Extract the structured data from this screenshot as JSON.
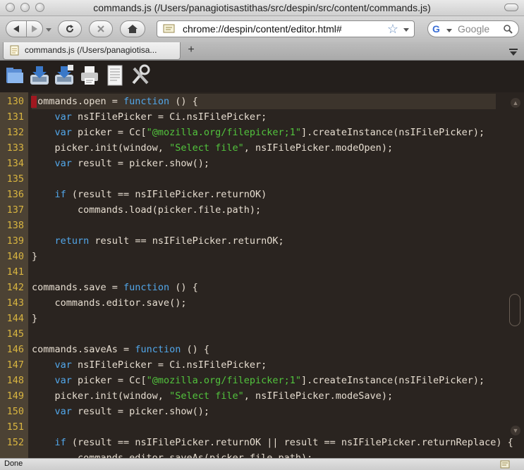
{
  "window": {
    "title": "commands.js (/Users/panagiotisastithas/src/despin/src/content/commands.js)"
  },
  "nav": {
    "url": "chrome://despin/content/editor.html#",
    "search_placeholder": "Google"
  },
  "tab": {
    "label": "commands.js (/Users/panagiotisa...",
    "add_label": "+"
  },
  "editor_tools": [
    "open-file-icon",
    "save-icon",
    "save-as-icon",
    "print-icon",
    "document-icon",
    "settings-icon"
  ],
  "colors": {
    "keyword": "#52a7ea",
    "string": "#52c33d",
    "line_number": "#d9b540",
    "text": "#e6ddd0",
    "cursor": "#a01820"
  },
  "code": {
    "lines": [
      {
        "num": "130",
        "parts": [
          {
            "t": "commands.open = "
          },
          {
            "t": "function",
            "c": "kw"
          },
          {
            "t": " () {"
          }
        ]
      },
      {
        "num": "131",
        "parts": [
          {
            "t": "    "
          },
          {
            "t": "var",
            "c": "kw"
          },
          {
            "t": " nsIFilePicker = Ci.nsIFilePicker;"
          }
        ]
      },
      {
        "num": "132",
        "parts": [
          {
            "t": "    "
          },
          {
            "t": "var",
            "c": "kw"
          },
          {
            "t": " picker = Cc["
          },
          {
            "t": "\"@mozilla.org/filepicker;1\"",
            "c": "str"
          },
          {
            "t": "].createInstance(nsIFilePicker);"
          }
        ]
      },
      {
        "num": "133",
        "parts": [
          {
            "t": "    picker.init(window, "
          },
          {
            "t": "\"Select file\"",
            "c": "str"
          },
          {
            "t": ", nsIFilePicker.modeOpen);"
          }
        ]
      },
      {
        "num": "134",
        "parts": [
          {
            "t": "    "
          },
          {
            "t": "var",
            "c": "kw"
          },
          {
            "t": " result = picker.show();"
          }
        ]
      },
      {
        "num": "135",
        "parts": []
      },
      {
        "num": "136",
        "parts": [
          {
            "t": "    "
          },
          {
            "t": "if",
            "c": "kw"
          },
          {
            "t": " (result == nsIFilePicker.returnOK)"
          }
        ]
      },
      {
        "num": "137",
        "parts": [
          {
            "t": "        commands.load(picker.file.path);"
          }
        ]
      },
      {
        "num": "138",
        "parts": []
      },
      {
        "num": "139",
        "parts": [
          {
            "t": "    "
          },
          {
            "t": "return",
            "c": "kw"
          },
          {
            "t": " result == nsIFilePicker.returnOK;"
          }
        ]
      },
      {
        "num": "140",
        "parts": [
          {
            "t": "}"
          }
        ]
      },
      {
        "num": "141",
        "parts": []
      },
      {
        "num": "142",
        "parts": [
          {
            "t": "commands.save = "
          },
          {
            "t": "function",
            "c": "kw"
          },
          {
            "t": " () {"
          }
        ]
      },
      {
        "num": "143",
        "parts": [
          {
            "t": "    commands.editor.save();"
          }
        ]
      },
      {
        "num": "144",
        "parts": [
          {
            "t": "}"
          }
        ]
      },
      {
        "num": "145",
        "parts": []
      },
      {
        "num": "146",
        "parts": [
          {
            "t": "commands.saveAs = "
          },
          {
            "t": "function",
            "c": "kw"
          },
          {
            "t": " () {"
          }
        ]
      },
      {
        "num": "147",
        "parts": [
          {
            "t": "    "
          },
          {
            "t": "var",
            "c": "kw"
          },
          {
            "t": " nsIFilePicker = Ci.nsIFilePicker;"
          }
        ]
      },
      {
        "num": "148",
        "parts": [
          {
            "t": "    "
          },
          {
            "t": "var",
            "c": "kw"
          },
          {
            "t": " picker = Cc["
          },
          {
            "t": "\"@mozilla.org/filepicker;1\"",
            "c": "str"
          },
          {
            "t": "].createInstance(nsIFilePicker);"
          }
        ]
      },
      {
        "num": "149",
        "parts": [
          {
            "t": "    picker.init(window, "
          },
          {
            "t": "\"Select file\"",
            "c": "str"
          },
          {
            "t": ", nsIFilePicker.modeSave);"
          }
        ]
      },
      {
        "num": "150",
        "parts": [
          {
            "t": "    "
          },
          {
            "t": "var",
            "c": "kw"
          },
          {
            "t": " result = picker.show();"
          }
        ]
      },
      {
        "num": "151",
        "parts": []
      },
      {
        "num": "152",
        "parts": [
          {
            "t": "    "
          },
          {
            "t": "if",
            "c": "kw"
          },
          {
            "t": " (result == nsIFilePicker.returnOK || result == nsIFilePicker.returnReplace) {"
          }
        ]
      },
      {
        "num": "",
        "parts": [
          {
            "t": "        commands.editor.saveAs(picker.file.path);"
          }
        ]
      }
    ]
  },
  "status": {
    "text": "Done"
  }
}
